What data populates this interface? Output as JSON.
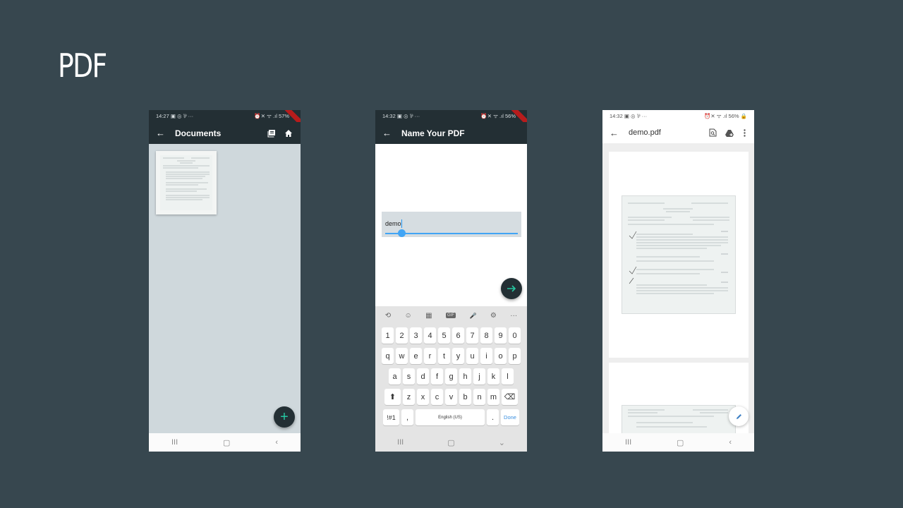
{
  "slide": {
    "title": "PDF"
  },
  "phone1": {
    "status": {
      "time": "14:27",
      "left_icons": "▣ ◎ ⅌ ···",
      "right": "⏰✕ ᯤ .ıl 57%"
    },
    "appbar": {
      "title": "Documents"
    },
    "fab_icon": "+"
  },
  "phone2": {
    "status": {
      "time": "14:32",
      "left_icons": "▣ ◎ ⅌ ···",
      "right": "⏰✕ ᯤ .ıl 56%"
    },
    "appbar": {
      "title": "Name Your PDF"
    },
    "input": {
      "value": "demo"
    },
    "keyboard": {
      "toolbar": [
        "☺",
        "▦",
        "GIF",
        "🎤",
        "⚙",
        "···"
      ],
      "row_numbers": [
        "1",
        "2",
        "3",
        "4",
        "5",
        "6",
        "7",
        "8",
        "9",
        "0"
      ],
      "row1": [
        "q",
        "w",
        "e",
        "r",
        "t",
        "y",
        "u",
        "i",
        "o",
        "p"
      ],
      "row2": [
        "a",
        "s",
        "d",
        "f",
        "g",
        "h",
        "j",
        "k",
        "l"
      ],
      "row3": [
        "z",
        "x",
        "c",
        "v",
        "b",
        "n",
        "m"
      ],
      "sym_key": "!#1",
      "comma_key": ",",
      "space_key": "English (US)",
      "period_key": ".",
      "done_key": "Done"
    }
  },
  "phone3": {
    "status": {
      "time": "14:32",
      "left_icons": "▣ ◎ ⅌ ···",
      "right": "⏰✕ ᯤ .ıl 56% 🔒"
    },
    "appbar": {
      "title": "demo.pdf"
    }
  },
  "colors": {
    "slide_bg": "#37474f",
    "appbar_dark": "#232f34",
    "content_grey": "#cfd8dc",
    "fab_accent": "#26c6a0",
    "input_accent": "#42a5f5"
  }
}
